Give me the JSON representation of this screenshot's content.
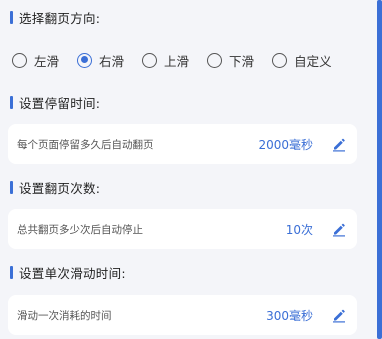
{
  "direction": {
    "title": "选择翻页方向:",
    "options": [
      "左滑",
      "右滑",
      "上滑",
      "下滑",
      "自定义"
    ],
    "selected": "右滑"
  },
  "stay_time": {
    "title": "设置停留时间:",
    "description": "每个页面停留多久后自动翻页",
    "value": "2000毫秒",
    "edit_icon": "pencil-icon"
  },
  "page_count": {
    "title": "设置翻页次数:",
    "description": "总共翻页多少次后自动停止",
    "value": "10次",
    "edit_icon": "pencil-icon"
  },
  "swipe_time": {
    "title": "设置单次滑动时间:",
    "description": "滑动一次消耗的时间",
    "value": "300毫秒",
    "edit_icon": "pencil-icon"
  },
  "colors": {
    "accent": "#3b6fd6",
    "background": "#f4f5f9",
    "card": "#ffffff"
  }
}
